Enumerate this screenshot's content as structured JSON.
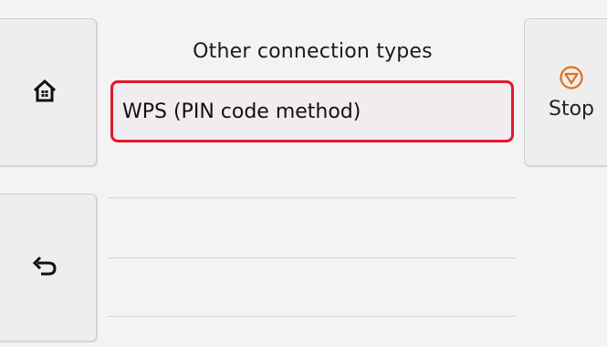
{
  "screen": {
    "title": "Other connection types",
    "home_button": {
      "icon": "home-icon"
    },
    "back_button": {
      "icon": "back-arrow-icon"
    },
    "stop_button": {
      "label": "Stop",
      "icon": "stop-icon",
      "icon_color": "#e0701c"
    },
    "list": {
      "items": [
        {
          "label": "WPS (PIN code method)",
          "selected": true
        }
      ],
      "selection_color": "#e0182b"
    }
  }
}
